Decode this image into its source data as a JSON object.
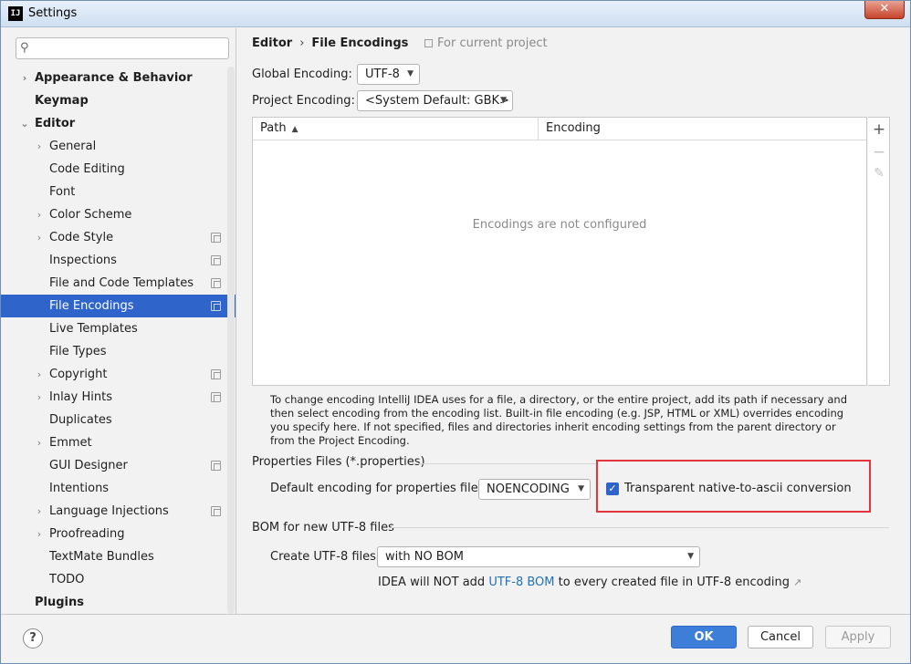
{
  "window": {
    "title": "Settings",
    "app_icon_text": "IJ",
    "close_glyph": "✕"
  },
  "search": {
    "placeholder": "",
    "value": ""
  },
  "sidebar": {
    "items": [
      {
        "label": "Appearance & Behavior",
        "level": 0,
        "chevron": "›",
        "bold": true,
        "project_icon": false,
        "selected": false
      },
      {
        "label": "Keymap",
        "level": 0,
        "chevron": "",
        "bold": true,
        "project_icon": false,
        "selected": false
      },
      {
        "label": "Editor",
        "level": 0,
        "chevron": "⌄",
        "bold": true,
        "project_icon": false,
        "selected": false
      },
      {
        "label": "General",
        "level": 1,
        "chevron": "›",
        "bold": false,
        "project_icon": false,
        "selected": false
      },
      {
        "label": "Code Editing",
        "level": 1,
        "chevron": "",
        "bold": false,
        "project_icon": false,
        "selected": false
      },
      {
        "label": "Font",
        "level": 1,
        "chevron": "",
        "bold": false,
        "project_icon": false,
        "selected": false
      },
      {
        "label": "Color Scheme",
        "level": 1,
        "chevron": "›",
        "bold": false,
        "project_icon": false,
        "selected": false
      },
      {
        "label": "Code Style",
        "level": 1,
        "chevron": "›",
        "bold": false,
        "project_icon": true,
        "selected": false
      },
      {
        "label": "Inspections",
        "level": 1,
        "chevron": "",
        "bold": false,
        "project_icon": true,
        "selected": false
      },
      {
        "label": "File and Code Templates",
        "level": 1,
        "chevron": "",
        "bold": false,
        "project_icon": true,
        "selected": false
      },
      {
        "label": "File Encodings",
        "level": 1,
        "chevron": "",
        "bold": false,
        "project_icon": true,
        "selected": true
      },
      {
        "label": "Live Templates",
        "level": 1,
        "chevron": "",
        "bold": false,
        "project_icon": false,
        "selected": false
      },
      {
        "label": "File Types",
        "level": 1,
        "chevron": "",
        "bold": false,
        "project_icon": false,
        "selected": false
      },
      {
        "label": "Copyright",
        "level": 1,
        "chevron": "›",
        "bold": false,
        "project_icon": true,
        "selected": false
      },
      {
        "label": "Inlay Hints",
        "level": 1,
        "chevron": "›",
        "bold": false,
        "project_icon": true,
        "selected": false
      },
      {
        "label": "Duplicates",
        "level": 1,
        "chevron": "",
        "bold": false,
        "project_icon": false,
        "selected": false
      },
      {
        "label": "Emmet",
        "level": 1,
        "chevron": "›",
        "bold": false,
        "project_icon": false,
        "selected": false
      },
      {
        "label": "GUI Designer",
        "level": 1,
        "chevron": "",
        "bold": false,
        "project_icon": true,
        "selected": false
      },
      {
        "label": "Intentions",
        "level": 1,
        "chevron": "",
        "bold": false,
        "project_icon": false,
        "selected": false
      },
      {
        "label": "Language Injections",
        "level": 1,
        "chevron": "›",
        "bold": false,
        "project_icon": true,
        "selected": false
      },
      {
        "label": "Proofreading",
        "level": 1,
        "chevron": "›",
        "bold": false,
        "project_icon": false,
        "selected": false
      },
      {
        "label": "TextMate Bundles",
        "level": 1,
        "chevron": "",
        "bold": false,
        "project_icon": false,
        "selected": false
      },
      {
        "label": "TODO",
        "level": 1,
        "chevron": "",
        "bold": false,
        "project_icon": false,
        "selected": false
      },
      {
        "label": "Plugins",
        "level": 0,
        "chevron": "",
        "bold": true,
        "project_icon": false,
        "selected": false
      }
    ]
  },
  "main": {
    "breadcrumb": {
      "parent": "Editor",
      "separator": "›",
      "current": "File Encodings"
    },
    "scope_note": "For current project",
    "global_encoding": {
      "label": "Global Encoding:",
      "value": "UTF-8"
    },
    "project_encoding": {
      "label": "Project Encoding:",
      "value": "<System Default: GBK>"
    },
    "table": {
      "columns": [
        "Path",
        "Encoding"
      ],
      "sort_glyph": "▲",
      "empty_message": "Encodings are not configured",
      "tools": {
        "add": "+",
        "remove": "−",
        "edit": "✎"
      }
    },
    "help_text": "To change encoding IntelliJ IDEA uses for a file, a directory, or the entire project, add its path if necessary and then select encoding from the encoding list. Built-in file encoding (e.g. JSP, HTML or XML) overrides encoding you specify here. If not specified, files and directories inherit encoding settings from the parent directory or from the Project Encoding.",
    "properties": {
      "section_title": "Properties Files (*.properties)",
      "default_label": "Default encoding for properties files:",
      "default_value": "NOENCODING",
      "transparent_label": "Transparent native-to-ascii conversion",
      "transparent_checked": true
    },
    "bom": {
      "section_title": "BOM for new UTF-8 files",
      "create_label": "Create UTF-8 files:",
      "create_value": "with NO BOM",
      "note_prefix": "IDEA will NOT add ",
      "note_link": "UTF-8 BOM",
      "note_suffix": " to every created file in UTF-8 encoding",
      "ext_glyph": "↗"
    }
  },
  "footer": {
    "help": "?",
    "ok": "OK",
    "cancel": "Cancel",
    "apply": "Apply"
  },
  "colors": {
    "selection": "#2f65ca",
    "link": "#2470b3",
    "highlight_box": "#e5343b",
    "primary_button": "#3d7fd8"
  },
  "icons": {
    "search": "search-icon",
    "project_scope": "project-scope-icon",
    "chevron": "chevron-icon"
  }
}
